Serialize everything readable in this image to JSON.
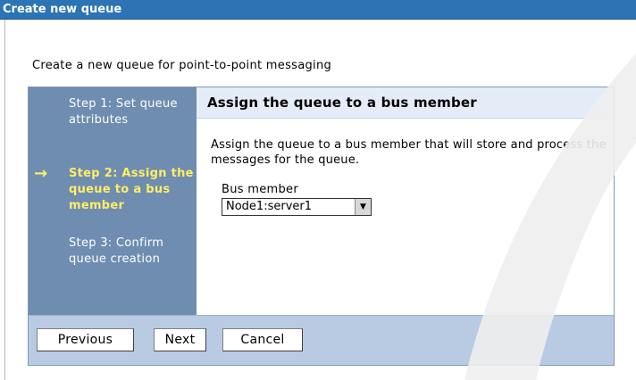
{
  "window": {
    "title": "Create new queue"
  },
  "intro": "Create a new queue for point-to-point messaging",
  "steps": [
    {
      "text": "Step 1: Set queue attributes",
      "current": false
    },
    {
      "text": "Step 2: Assign the queue to a bus member",
      "current": true
    },
    {
      "text": "Step 3: Confirm queue creation",
      "current": false
    }
  ],
  "content": {
    "title": "Assign the queue to a bus member",
    "description": "Assign the queue to a bus member that will store and process the messages for the queue.",
    "bus_member_label": "Bus member",
    "bus_member_value": "Node1:server1"
  },
  "buttons": {
    "previous": "Previous",
    "next": "Next",
    "cancel": "Cancel"
  },
  "colors": {
    "title_bar": "#2c74b4",
    "step_panel": "#6f8db0",
    "current_step": "#ffee66",
    "button_bar": "#b8cbe2"
  },
  "icons": {
    "current_step": "arrow-right-icon",
    "select_dropdown": "chevron-down-icon"
  }
}
